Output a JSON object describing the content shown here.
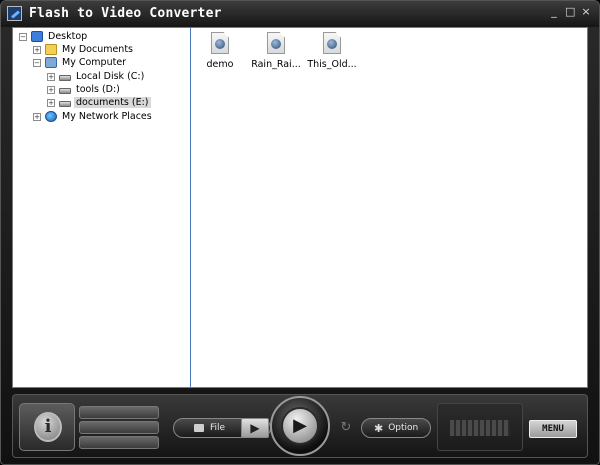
{
  "window": {
    "title": "Flash to Video Converter",
    "controls": {
      "minimize": "_",
      "maximize": "□",
      "close": "×"
    }
  },
  "tree": {
    "items": [
      {
        "label": "Desktop",
        "expander": "−",
        "icon": "desktop-icon"
      },
      {
        "label": "My Documents",
        "expander": "+",
        "icon": "folder-icon"
      },
      {
        "label": "My Computer",
        "expander": "−",
        "icon": "computer-icon"
      },
      {
        "label": "Local Disk (C:)",
        "expander": "+",
        "icon": "drive-icon"
      },
      {
        "label": "tools (D:)",
        "expander": "+",
        "icon": "drive-icon"
      },
      {
        "label": "documents (E:)",
        "expander": "+",
        "icon": "drive-icon",
        "selected": true
      },
      {
        "label": "My Network Places",
        "expander": "+",
        "icon": "network-icon"
      }
    ]
  },
  "files": [
    {
      "name": "demo"
    },
    {
      "name": "Rain_Rai..."
    },
    {
      "name": "This_Old..."
    }
  ],
  "controlbar": {
    "info_glyph": "i",
    "file_label": "File",
    "file_step_glyph": "▶",
    "play_glyph": "▶",
    "refresh_glyph": "↻",
    "option_label": "Option",
    "option_glyph": "✱",
    "menu_label": "MENU"
  }
}
